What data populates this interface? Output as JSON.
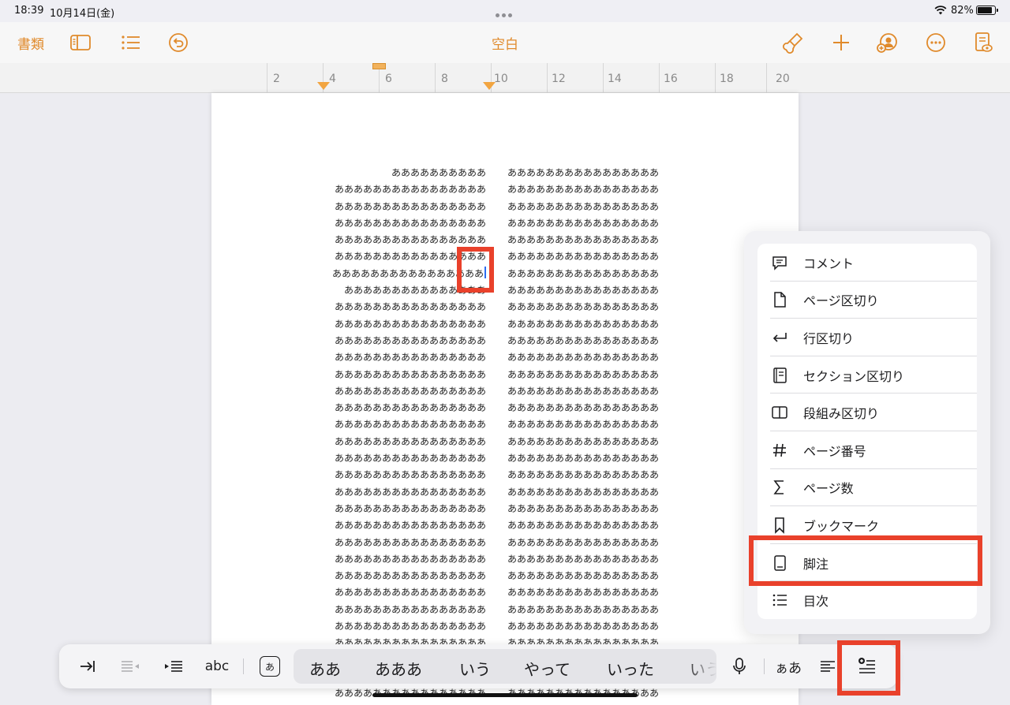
{
  "status": {
    "time": "18:39",
    "date": "10月14日(金)",
    "battery": "82%",
    "battery_level": 0.82
  },
  "toolbar": {
    "docs_label": "書類",
    "title": "空白"
  },
  "ruler": {
    "labels": [
      "2",
      "4",
      "6",
      "8",
      "10",
      "12",
      "14",
      "16",
      "18",
      "20"
    ]
  },
  "document": {
    "left_column": [
      "ああああああああああ",
      "ああああああああああああああああ",
      "ああああああああああああああああ",
      "ああああああああああああああああ",
      "ああああああああああああああああ",
      "ああああああああああああああああ",
      "ああああああああああああああああ",
      "あああああああああああああああ",
      "ああああああああああああああああ",
      "ああああああああああああああああ",
      "ああああああああああああああああ",
      "ああああああああああああああああ",
      "ああああああああああああああああ",
      "ああああああああああああああああ",
      "ああああああああああああああああ",
      "ああああああああああああああああ",
      "ああああああああああああああああ",
      "ああああああああああああああああ",
      "ああああああああああああああああ",
      "ああああああああああああああああ",
      "ああああああああああああああああ",
      "ああああああああああああああああ",
      "ああああああああああああああああ",
      "ああああああああああああああああ",
      "ああああああああああああああああ",
      "ああああああああああああああああ",
      "ああああああああああああああああ",
      "ああああああああああああああああ",
      "ああああああああああああああああ",
      "ああああああああああああああああ",
      "ああああああああああああああああ",
      "ああああああああああああああああ",
      "ああああああああああああああああ"
    ],
    "right_column_line": "ああああああああああああああああ",
    "right_line_count": 33
  },
  "popover_menu": {
    "items": [
      {
        "label": "コメント",
        "icon": "comment-icon"
      },
      {
        "label": "ページ区切り",
        "icon": "page-icon"
      },
      {
        "label": "行区切り",
        "icon": "return-icon"
      },
      {
        "label": "セクション区切り",
        "icon": "section-icon"
      },
      {
        "label": "段組み区切り",
        "icon": "columns-icon"
      },
      {
        "label": "ページ番号",
        "icon": "hash-icon"
      },
      {
        "label": "ページ数",
        "icon": "sigma-icon"
      },
      {
        "label": "ブックマーク",
        "icon": "bookmark-icon"
      },
      {
        "label": "脚注",
        "icon": "footnote-icon"
      },
      {
        "label": "目次",
        "icon": "list-icon"
      }
    ]
  },
  "shortcut_bar": {
    "abc_label": "abc",
    "kana_label": "あ",
    "predictions": [
      "ああ",
      "あああ",
      "いう",
      "やって",
      "いった",
      "いう"
    ],
    "small_kana_label": "ぁあ"
  },
  "colors": {
    "accent": "#e08a2b",
    "highlight": "#e9412b",
    "cursor": "#2d6cf0"
  }
}
